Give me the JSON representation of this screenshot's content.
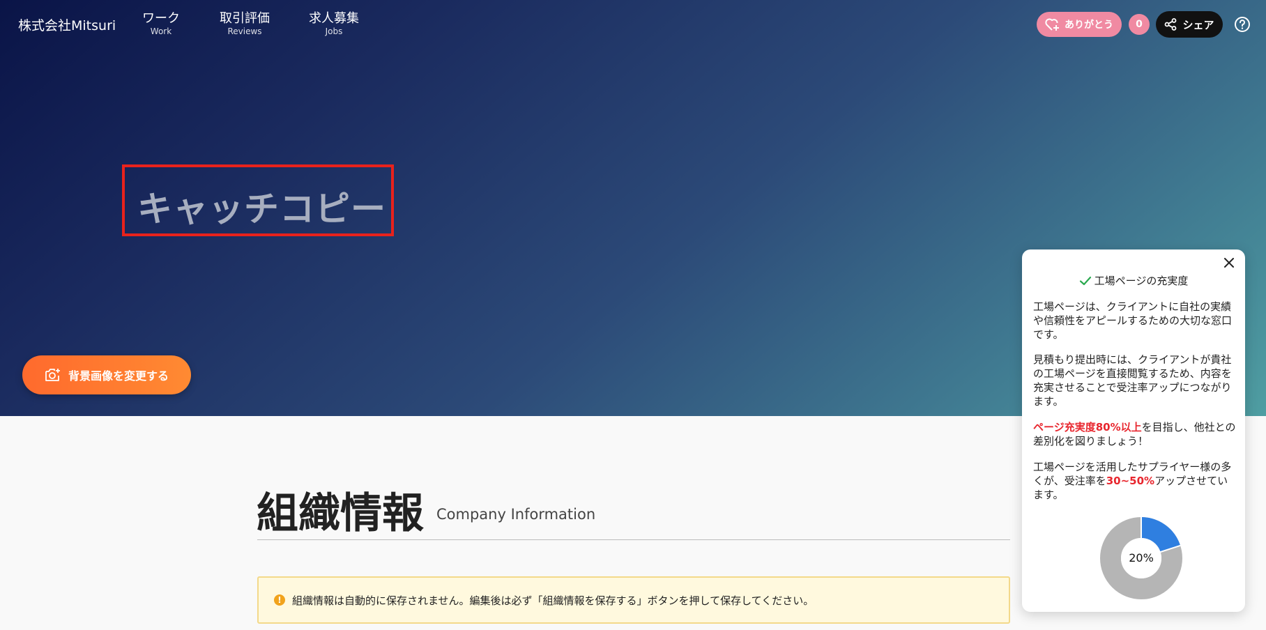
{
  "header": {
    "brand": "株式会社Mitsuri",
    "nav": [
      {
        "jp": "ワーク",
        "en": "Work"
      },
      {
        "jp": "取引評価",
        "en": "Reviews"
      },
      {
        "jp": "求人募集",
        "en": "Jobs"
      }
    ],
    "thanks_label": "ありがとう",
    "thanks_count": "0",
    "share_label": "シェア",
    "help_icon": "question-circle-icon"
  },
  "hero": {
    "catch_copy": "キャッチコピー",
    "change_bg_label": "背景画像を変更する",
    "camera_icon": "camera-plus-icon"
  },
  "section": {
    "title": "組織情報",
    "subtitle": "Company Information",
    "notice": "組織情報は自動的に保存されません。編集後は必ず「組織情報を保存する」ボタンを押して保存してください。"
  },
  "panel": {
    "title": "工場ページの充実度",
    "p1": "工場ページは、クライアントに自社の実績や信頼性をアピールするための大切な窓口です。",
    "p2": "見積もり提出時には、クライアントが貴社の工場ページを直接閲覧するため、内容を充実させることで受注率アップにつながります。",
    "p3_highlight": "ページ充実度80%以上",
    "p3_rest": "を目指し、他社との差別化を図りましょう！",
    "p4_before": "工場ページを活用したサプライヤー様の多くが、受注率を",
    "p4_highlight": "30~50%",
    "p4_after": "アップさせています。",
    "completion_percent": 20,
    "completion_label": "20%"
  },
  "colors": {
    "accent_orange": "#ff6a2d",
    "thanks_pink": "#f08aa2",
    "highlight_red": "#e8262e",
    "donut_fill": "#2f7fe0",
    "donut_track": "#b5b5b5",
    "catch_border": "#e8221c"
  }
}
